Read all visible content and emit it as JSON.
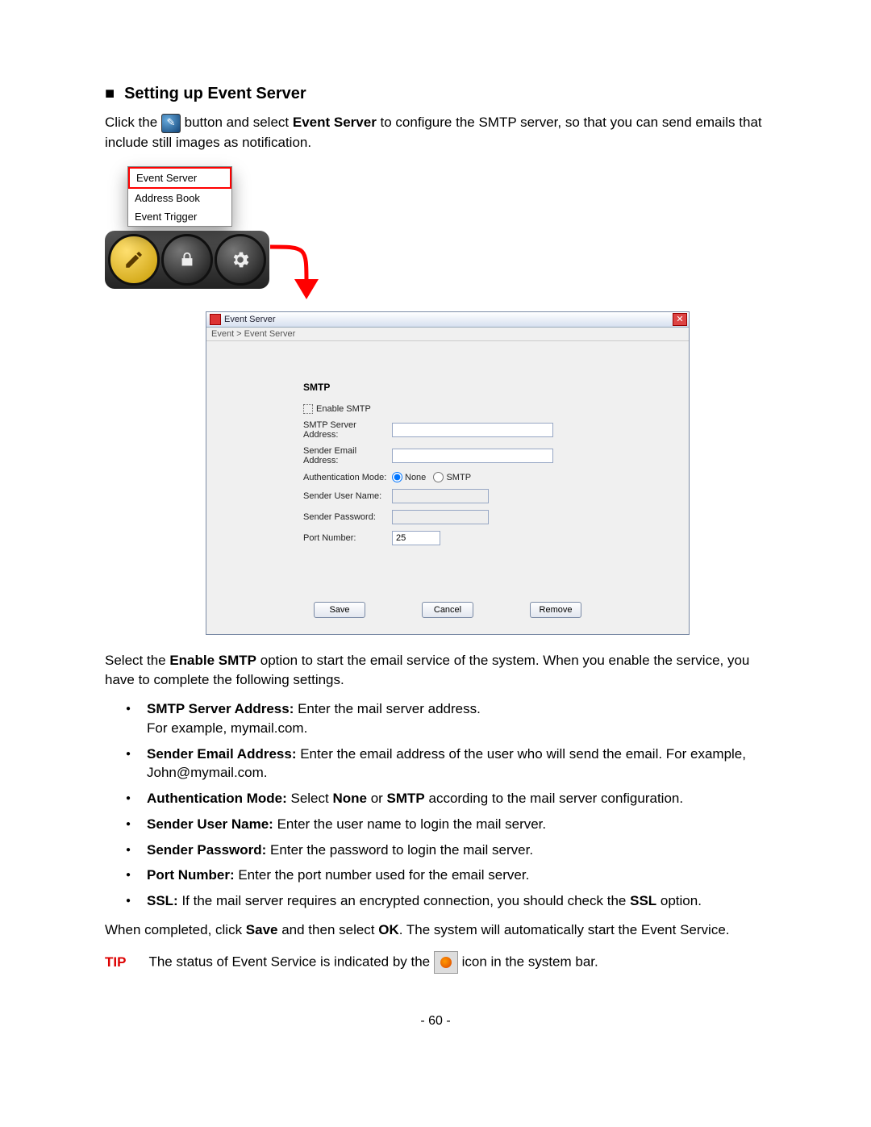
{
  "heading": "Setting up Event Server",
  "intro": {
    "before": "Click the ",
    "mid1": " button and select ",
    "bold1": "Event Server",
    "after": " to configure the SMTP server, so that you can send emails that include still images as notification."
  },
  "menu": {
    "items": [
      "Event Server",
      "Address Book",
      "Event Trigger"
    ]
  },
  "dialog": {
    "title": "Event Server",
    "breadcrumb": "Event > Event Server",
    "section": "SMTP",
    "enable_label": "Enable SMTP",
    "rows": {
      "server_addr": "SMTP Server Address:",
      "sender_email": "Sender Email Address:",
      "auth_mode": "Authentication Mode:",
      "auth_none": "None",
      "auth_smtp": "SMTP",
      "sender_user": "Sender User Name:",
      "sender_pass": "Sender Password:",
      "port": "Port Number:",
      "port_value": "25"
    },
    "buttons": {
      "save": "Save",
      "cancel": "Cancel",
      "remove": "Remove"
    }
  },
  "para2": {
    "before": "Select the ",
    "bold": "Enable SMTP",
    "after": " option to start the email service of the system. When you enable the service, you have to complete the following settings."
  },
  "bullets": [
    {
      "label": "SMTP Server Address:",
      "text": " Enter the mail server address.",
      "text2": "For example, mymail.com."
    },
    {
      "label": "Sender Email Address:",
      "text": " Enter the email address of the user who will send the email. For example, John@mymail.com."
    },
    {
      "label": "Authentication Mode:",
      "parts": [
        " Select ",
        "None",
        " or ",
        "SMTP",
        " according to the mail server configuration."
      ]
    },
    {
      "label": "Sender User Name:",
      "text": " Enter the user name to login the mail server."
    },
    {
      "label": "Sender Password:",
      "text": " Enter the password to login the mail server."
    },
    {
      "label": "Port Number:",
      "text": " Enter the port number used for the email server."
    },
    {
      "label": "SSL:",
      "parts": [
        " If the mail server requires an encrypted connection, you should check the ",
        "SSL",
        " option."
      ]
    }
  ],
  "para3": {
    "before": "When completed, click ",
    "b1": "Save",
    "mid": " and then select ",
    "b2": "OK",
    "after": ". The system will automatically start the Event Service."
  },
  "tip": {
    "label": "TIP",
    "before": "The status of Event Service is indicated by the ",
    "after": " icon in the system bar."
  },
  "pagenum": "- 60 -"
}
